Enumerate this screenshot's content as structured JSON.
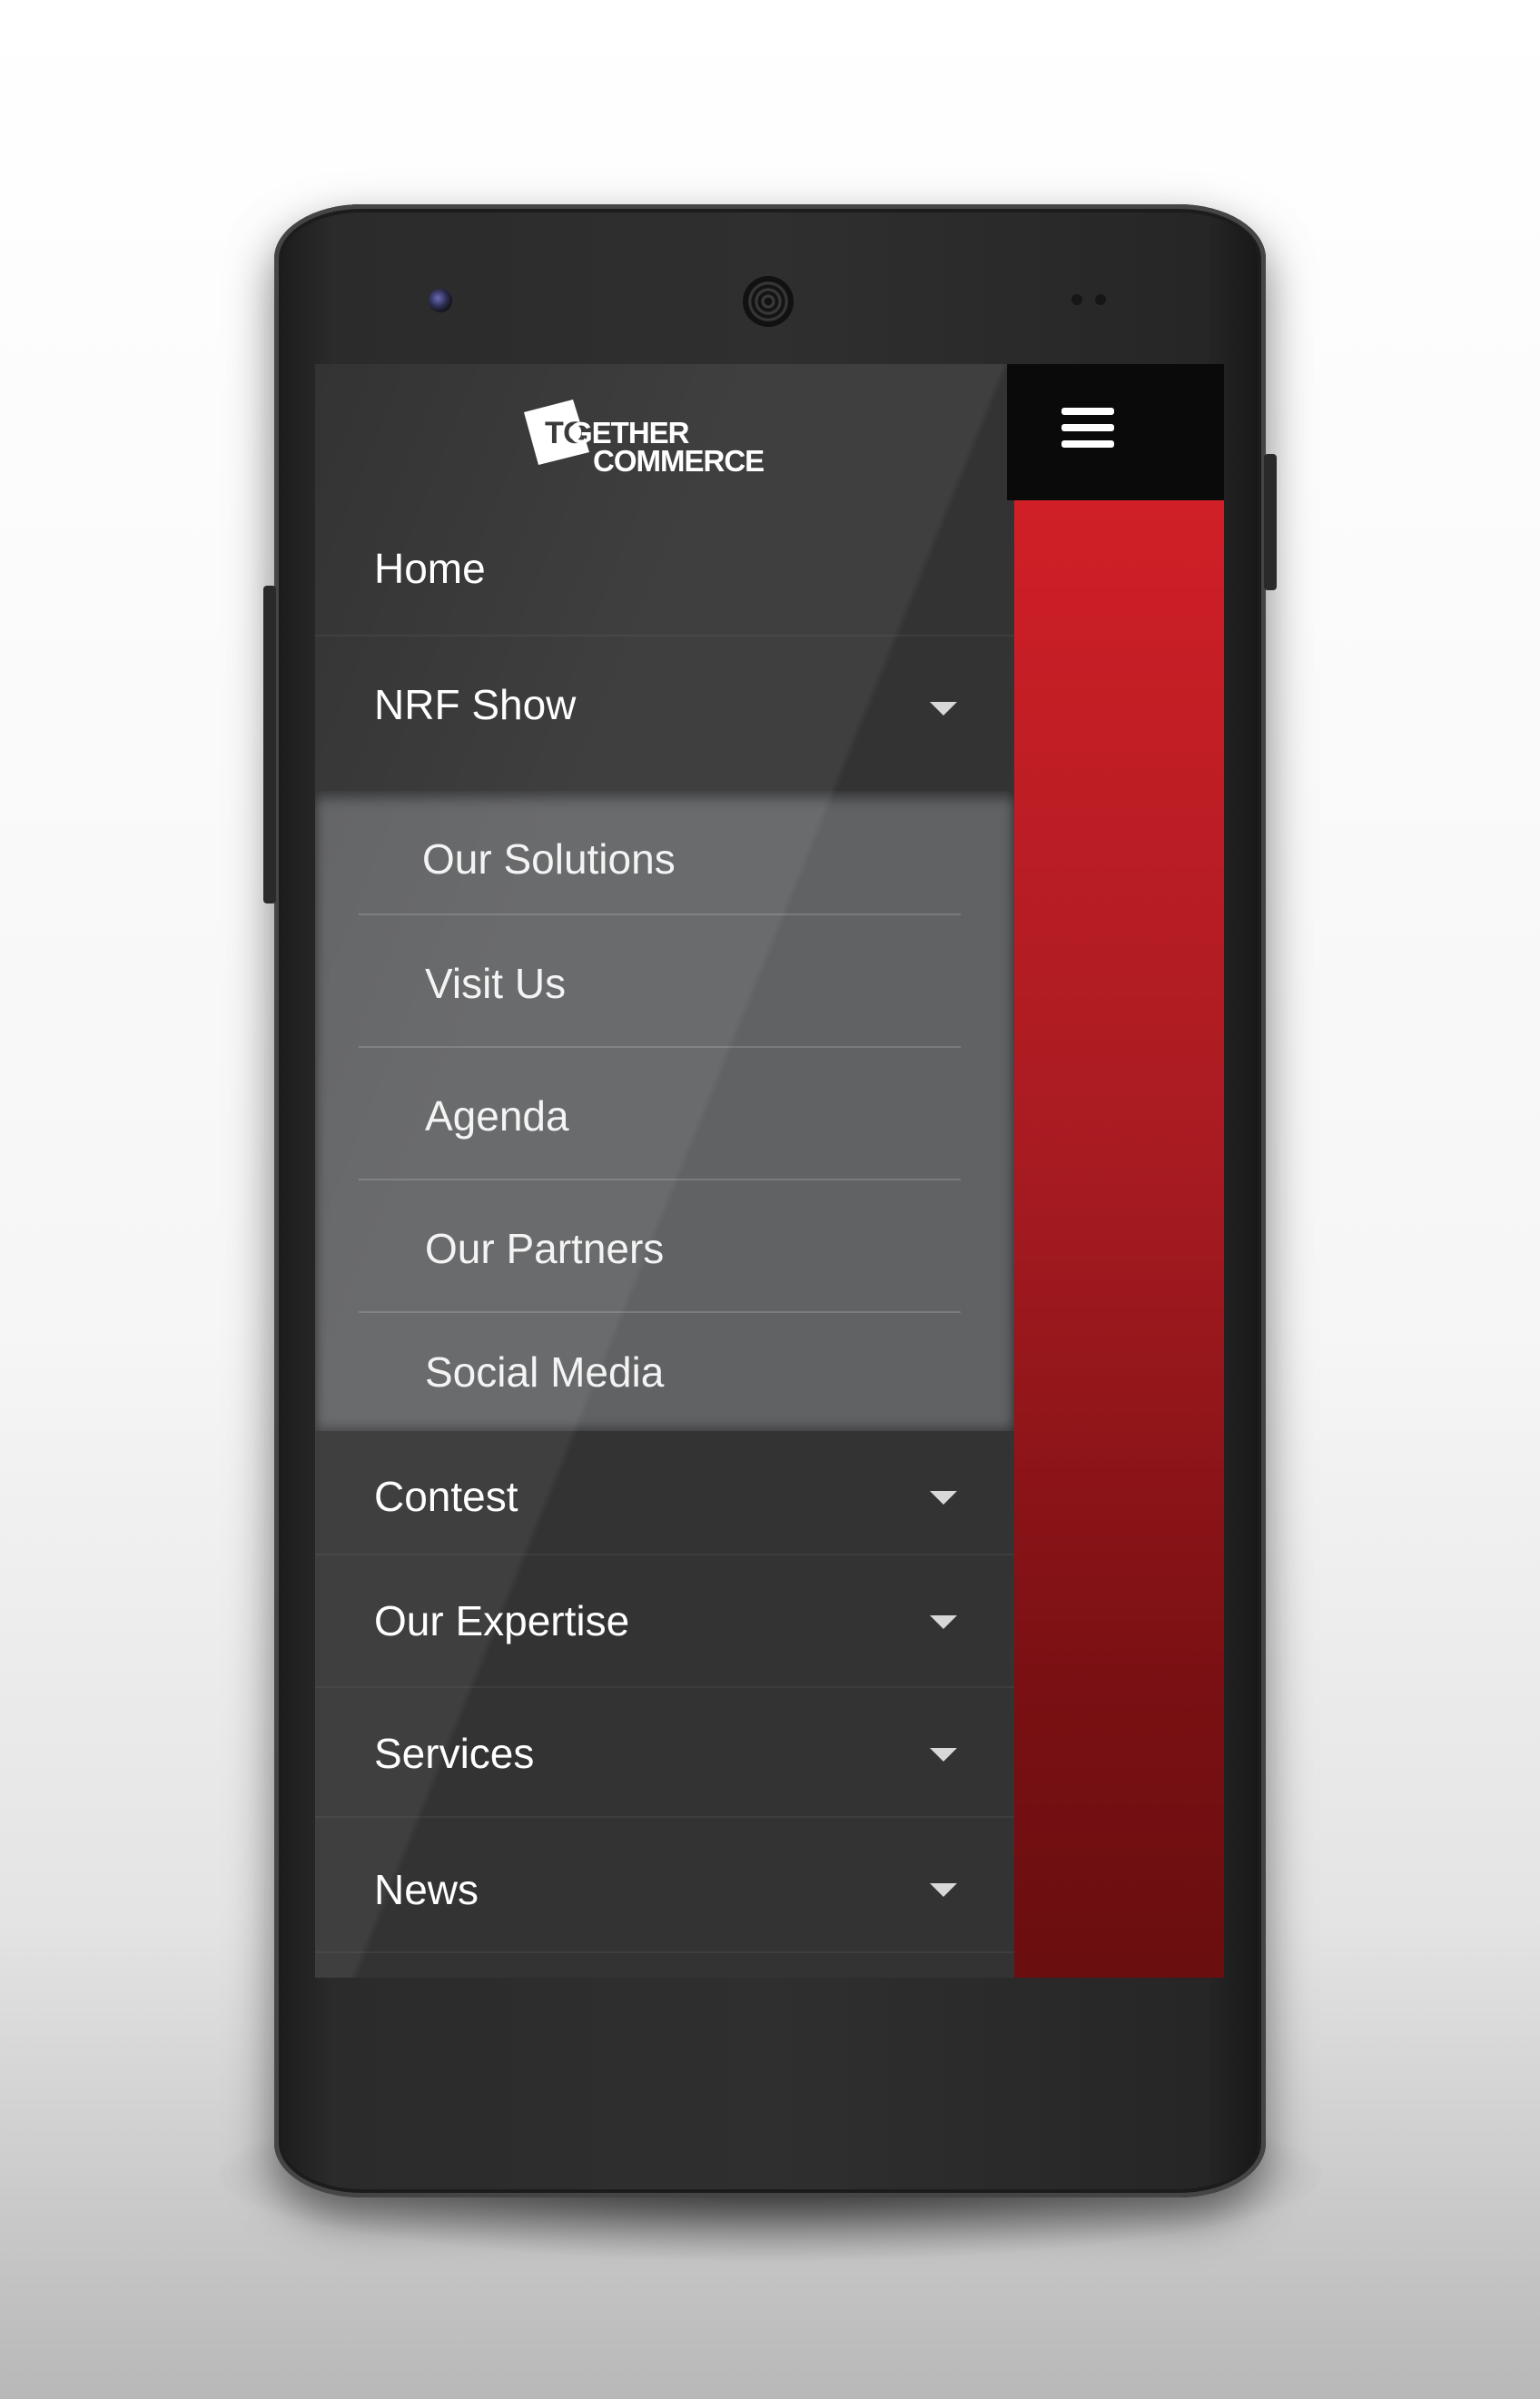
{
  "brand": {
    "logo_mark": "TO",
    "logo_line1": "GETHER",
    "logo_line2": "COMMERCE"
  },
  "header": {
    "menu_icon": "hamburger-icon"
  },
  "menu": {
    "items": [
      {
        "label": "Home",
        "has_caret": false
      },
      {
        "label": "NRF Show",
        "has_caret": true,
        "expanded": true
      },
      {
        "label": "Contest",
        "has_caret": true
      },
      {
        "label": "Our Expertise",
        "has_caret": true
      },
      {
        "label": "Services",
        "has_caret": true
      },
      {
        "label": "News",
        "has_caret": true
      }
    ],
    "submenu": [
      {
        "label": "Our Solutions"
      },
      {
        "label": "Visit Us"
      },
      {
        "label": "Agenda"
      },
      {
        "label": "Our Partners"
      },
      {
        "label": "Social Media"
      }
    ]
  },
  "colors": {
    "drawer_bg": "#333333",
    "submenu_bg": "#616264",
    "topbar_bg": "#0a0a0a",
    "accent_red": "#d01f27"
  }
}
